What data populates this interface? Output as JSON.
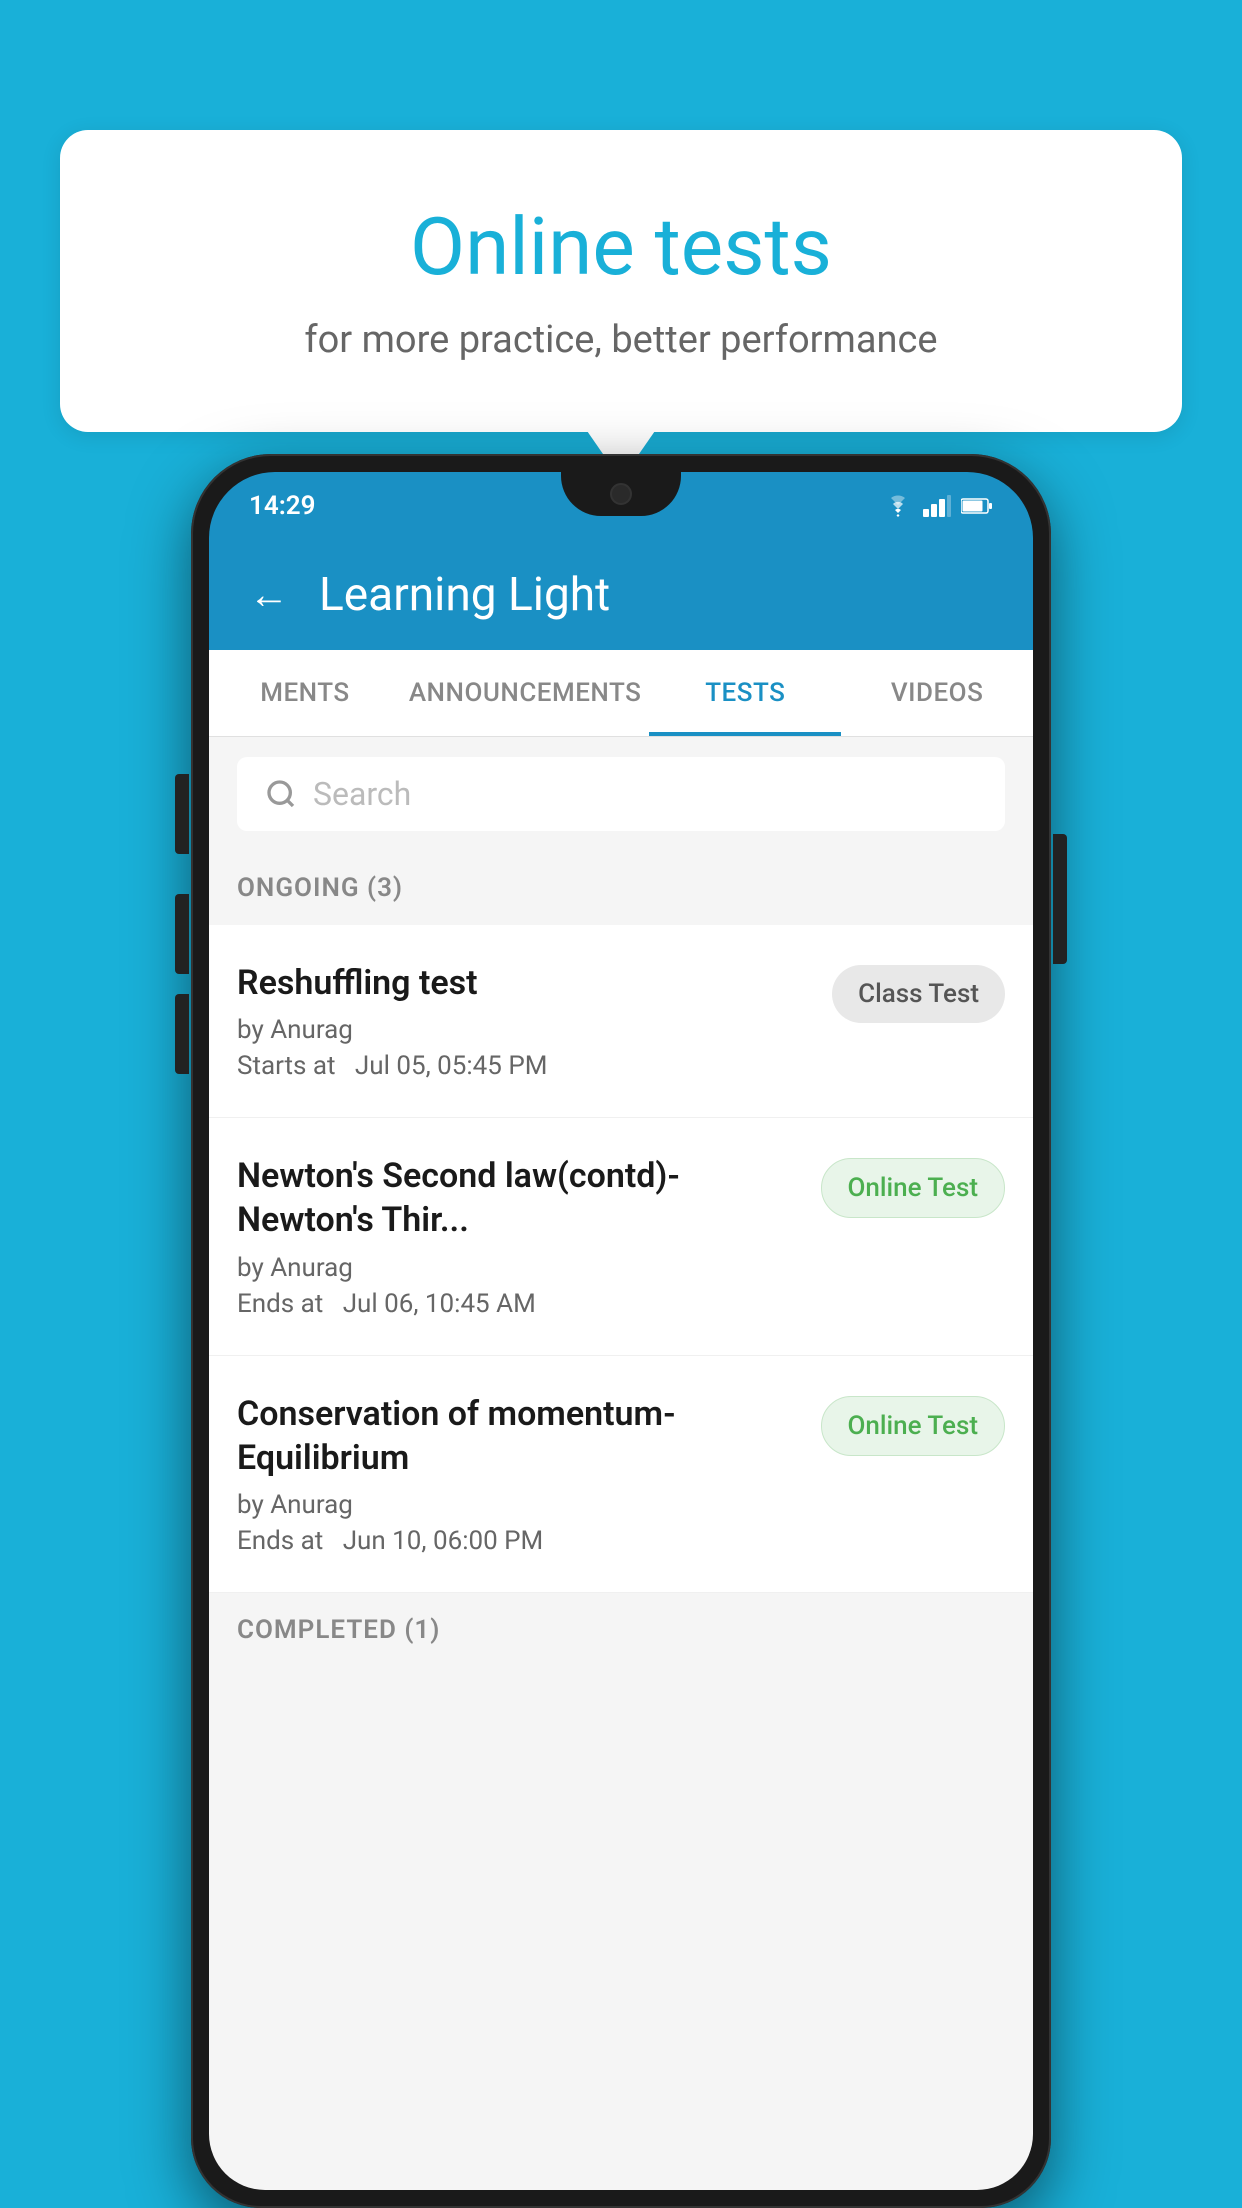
{
  "background_color": "#19b0d8",
  "speech_bubble": {
    "title": "Online tests",
    "subtitle": "for more practice, better performance"
  },
  "phone": {
    "status_bar": {
      "time": "14:29",
      "icons": [
        "wifi",
        "signal",
        "battery"
      ]
    },
    "app_header": {
      "back_label": "←",
      "title": "Learning Light"
    },
    "tabs": [
      {
        "label": "MENTS",
        "active": false
      },
      {
        "label": "ANNOUNCEMENTS",
        "active": false
      },
      {
        "label": "TESTS",
        "active": true
      },
      {
        "label": "VIDEOS",
        "active": false
      }
    ],
    "search": {
      "placeholder": "Search"
    },
    "ongoing_section": {
      "label": "ONGOING (3)"
    },
    "tests": [
      {
        "name": "Reshuffling test",
        "author": "by Anurag",
        "time_label": "Starts at",
        "time": "Jul 05, 05:45 PM",
        "badge": "Class Test",
        "badge_type": "class"
      },
      {
        "name": "Newton's Second law(contd)-Newton's Thir...",
        "author": "by Anurag",
        "time_label": "Ends at",
        "time": "Jul 06, 10:45 AM",
        "badge": "Online Test",
        "badge_type": "online"
      },
      {
        "name": "Conservation of momentum-Equilibrium",
        "author": "by Anurag",
        "time_label": "Ends at",
        "time": "Jun 10, 06:00 PM",
        "badge": "Online Test",
        "badge_type": "online"
      }
    ],
    "completed_section": {
      "label": "COMPLETED (1)"
    }
  }
}
